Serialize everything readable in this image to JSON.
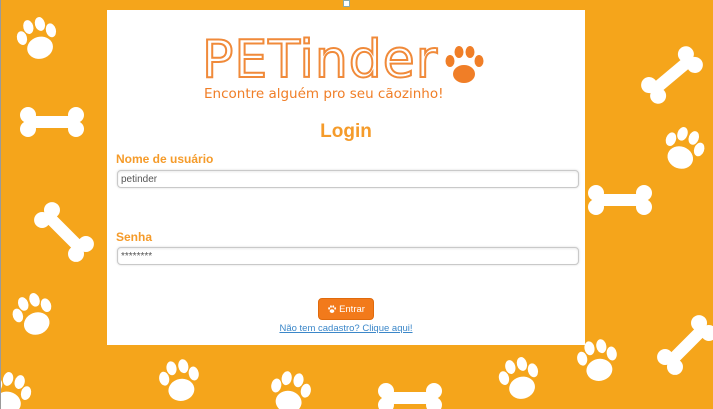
{
  "logo": {
    "text": "PETinder",
    "icon": "paw-icon"
  },
  "tagline": "Encontre alguém pro seu cãozinho!",
  "login_title": "Login",
  "username": {
    "label": "Nome de usuário",
    "value": "petinder",
    "placeholder": ""
  },
  "password": {
    "label": "Senha",
    "value": "********",
    "placeholder": ""
  },
  "submit": {
    "label": "Entrar",
    "icon": "paw-icon"
  },
  "signup_link": "Não tem cadastro? Clique aqui!",
  "colors": {
    "background": "#f5a51b",
    "accent": "#f27a1b",
    "label": "#f59b2a",
    "link": "#3b87c9"
  }
}
